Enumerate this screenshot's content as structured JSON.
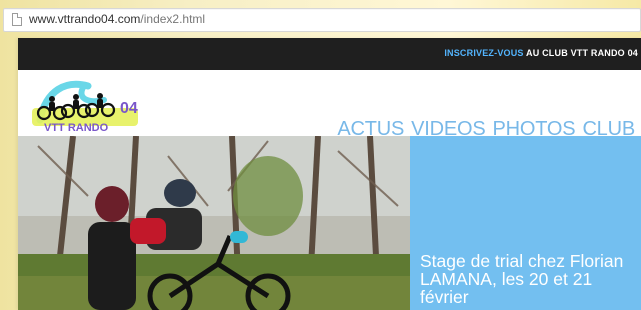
{
  "browser": {
    "url_host": "www.vttrando04.com",
    "url_path": "/index2.html"
  },
  "site": {
    "topbar": {
      "accent": "INSCRIVEZ-VOUS",
      "rest": " AU CLUB VTT RANDO 04"
    },
    "logo": {
      "number": "04",
      "letters": "VTT RANDO"
    },
    "nav": [
      {
        "label": "ACTUS"
      },
      {
        "label": "VIDEOS"
      },
      {
        "label": "PHOTOS"
      },
      {
        "label": "CLUB"
      }
    ],
    "hero": {
      "caption": "Stage de trial chez Florian LAMANA, les 20 et 21 février"
    }
  },
  "colors": {
    "accent_blue": "#53b5ff",
    "nav_blue": "#78b8e8",
    "caption_panel": "#73bff0",
    "topbar": "#1f1f1f"
  }
}
